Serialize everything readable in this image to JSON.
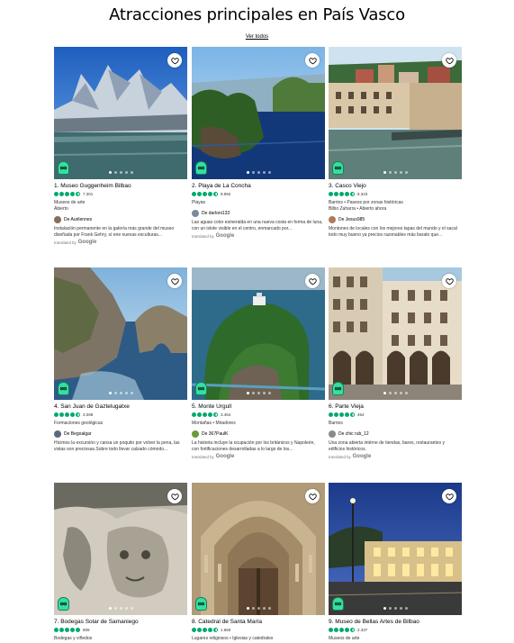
{
  "page": {
    "title": "Atracciones principales en País Vasco",
    "see_all": "Ver todos"
  },
  "colors": {
    "bubble": "#00aa6c",
    "award": "#34e0a1"
  },
  "cards": [
    {
      "rank_name": "1. Museo Guggenheim Bilbao",
      "count": "7.301",
      "rating": 4.5,
      "category": "Museos de arte",
      "extra": "Abierto",
      "author": "De Aurilennes",
      "review": "Instalación permanente en la galería más grande del museo diseñada por Frank Gehry, sí ene nuevas esculturas...",
      "translated_label": "translated by",
      "google_label": "Google",
      "image_icon": "guggenheim-photo"
    },
    {
      "rank_name": "2. Playa de La Concha",
      "count": "9.992",
      "rating": 4.5,
      "category": "Playas",
      "extra": "",
      "author": "De darloni133",
      "review": "Las aguas color esmeralda en una nueva costa en forma de luna, con un islote visible en el centro, enmarcado por...",
      "translated_label": "translated by",
      "google_label": "Google",
      "image_icon": "concha-photo"
    },
    {
      "rank_name": "3. Casco Viejo",
      "count": "8.343",
      "rating": 4.5,
      "category": "Barrios • Paseos por zonas históricas",
      "extra": "Bilbo Zaharra • Abierto ahora",
      "author": "De Jesus985",
      "review": "Montones de locales con los mejores tapas del mundo y el sacal todo muy bueno ya precios razonables más barato que...",
      "translated_label": "",
      "google_label": "",
      "image_icon": "casco-viejo-photo"
    },
    {
      "rank_name": "4. San Juan de Gaztelugatxe",
      "count": "3.098",
      "rating": 4.5,
      "category": "Formaciones geológicas",
      "extra": "",
      "author": "De Begoalgar",
      "review": "Hicimos la excursión y cansa un poquito por volver la pena, las vistas son preciosas.Sobre todo llevar calzado cómodo...",
      "translated_label": "",
      "google_label": "",
      "image_icon": "gaztelugatxe-photo"
    },
    {
      "rank_name": "5. Monte Urgull",
      "count": "3.454",
      "rating": 4.5,
      "category": "Montañas • Miradores",
      "extra": "",
      "author": "De 367PaulK",
      "review": "La historia incluye la ocupación por los británicos y Napoleón, con fortificaciones desarrolladas a lo largo de los...",
      "translated_label": "translated by",
      "google_label": "Google",
      "image_icon": "urgull-photo"
    },
    {
      "rank_name": "6. Parte Vieja",
      "count": "454",
      "rating": 4.5,
      "category": "Barrios",
      "extra": "",
      "author": "De chic rub_12",
      "review": "Una zona abierta intérne de tiendas, bares, restaurantes y edificios históricos.",
      "translated_label": "translated by",
      "google_label": "Google",
      "image_icon": "parte-vieja-photo"
    },
    {
      "rank_name": "7. Bodegas Solar de Samaniego",
      "count": "809",
      "rating": 5,
      "category": "Bodegas y viñedos",
      "extra": "",
      "author": "",
      "review": "",
      "translated_label": "",
      "google_label": "",
      "image_icon": "samaniego-photo"
    },
    {
      "rank_name": "8. Catedral de Santa María",
      "count": "1.660",
      "rating": 4.5,
      "category": "Lugares religiosos • Iglesias y catedrales",
      "extra": "",
      "author": "",
      "review": "",
      "translated_label": "",
      "google_label": "",
      "image_icon": "santa-maria-photo"
    },
    {
      "rank_name": "9. Museo de Bellas Artes de Bilbao",
      "count": "2.337",
      "rating": 4.5,
      "category": "Museos de arte",
      "extra": "",
      "author": "",
      "review": "",
      "translated_label": "",
      "google_label": "",
      "image_icon": "bellas-artes-photo"
    }
  ]
}
